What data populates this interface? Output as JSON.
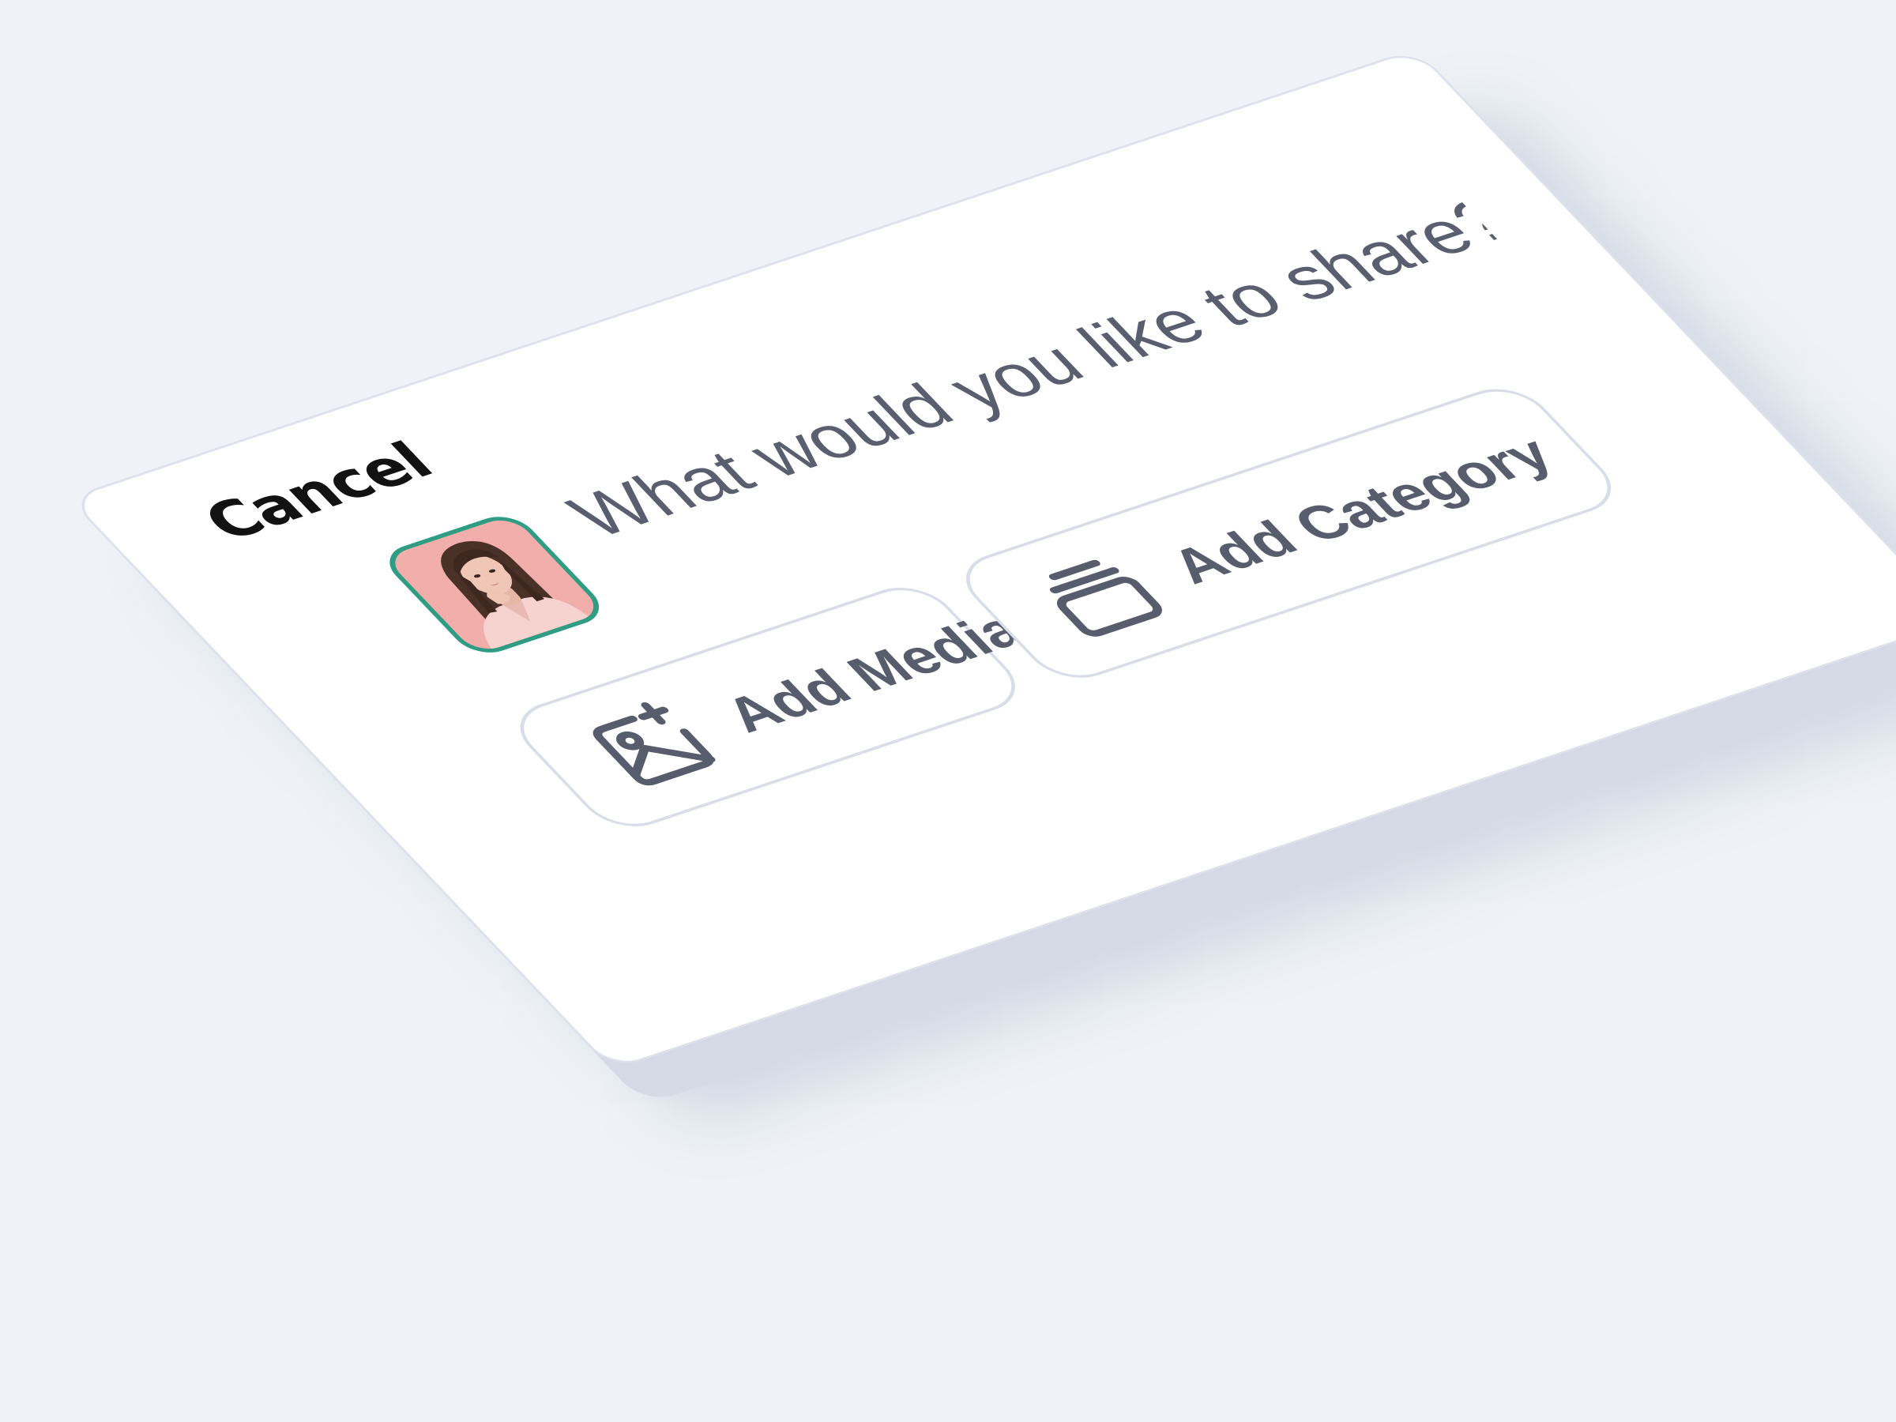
{
  "composer": {
    "cancel_label": "Cancel",
    "placeholder": "What would you like to share?",
    "avatar_alt": "user avatar"
  },
  "actions": {
    "add_media_label": "Add Media",
    "add_media_icon": "image-plus-icon",
    "add_category_label": "Add Category",
    "add_category_icon": "layers-icon"
  },
  "colors": {
    "page_background": "#eff3f8",
    "card_background": "#ffffff",
    "card_border": "#dde1ec",
    "avatar_ring": "#2e9d83",
    "avatar_background": "#f1aeab",
    "text_primary": "#121212",
    "text_muted": "#5a5f70",
    "button_border": "#d9dde8"
  }
}
